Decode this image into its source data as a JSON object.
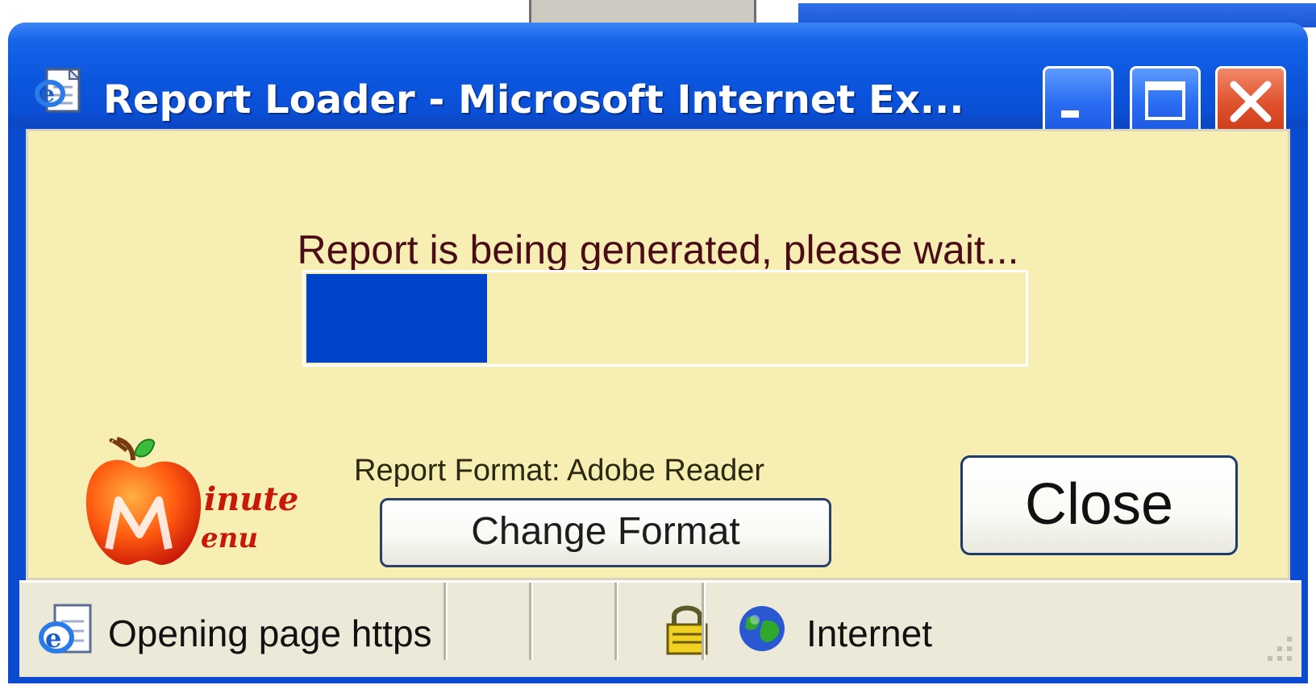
{
  "window": {
    "title": "Report Loader - Microsoft Internet Ex...",
    "icon": "ie-document-icon",
    "controls": [
      "minimize",
      "maximize",
      "close"
    ]
  },
  "content": {
    "status_message": "Report is being generated, please wait...",
    "progress": 0.255,
    "logo_icon": "minute-menu-logo",
    "logo_text_line1": "inute",
    "logo_text_line2": "enu",
    "format_label": "Report Format: Adobe Reader",
    "change_format_label": "Change Format",
    "close_label": "Close"
  },
  "statusbar": {
    "status_text": "Opening page https",
    "zone": "Internet",
    "icons": [
      "ie-page-icon",
      "lock-icon",
      "globe-icon",
      "resize-grip-icon"
    ]
  },
  "colors": {
    "title_bar": "#0a4bd0",
    "client_bg": "#f6eeb2",
    "progress_fill": "#0042c8",
    "message_text": "#4a0d18",
    "close_control": "#e0522e"
  }
}
